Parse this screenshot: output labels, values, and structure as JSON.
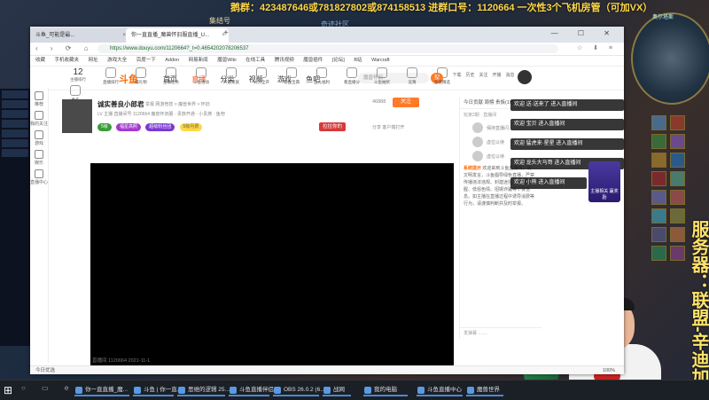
{
  "overlay": {
    "top_banner": "鹅群：423487646或781827802或874158513   进群口号：1120664   一次性3个飞机房管（可加VX）",
    "game_label_1": "集结号",
    "game_label_2": "奇迹社区",
    "server_vertical": "服务器：联盟-辛迪加",
    "minimap_label": "奥尔塔斯",
    "notifications": [
      "欢迎 送·送来了 进入直播间",
      "欢迎 宝贝 进入直播间",
      "欢迎 猛虎来·星星 进入直播间",
      "欢迎 龙头大马哥 进入直播间",
      "欢迎 小熊 进入直播间"
    ],
    "side_card": "主播相关 赢奖励"
  },
  "browser": {
    "tabs": [
      {
        "label": "斗鱼_可能是最..."
      },
      {
        "label": "你一直直播_魔兽怀旧服直播_U..."
      }
    ],
    "url": "https://www.douyu.com/1120664?_t=0.4654202078206537",
    "bookmarks": [
      "收藏",
      "手机收藏夹",
      "网址",
      "游戏大全",
      "百度一下",
      "Addon",
      "网易新闻",
      "魔兽Wiki",
      "在线工具",
      "腾讯视频",
      "魔兽插件",
      "[论坛]",
      "B站",
      "Warcraft"
    ],
    "status_left": "今日优选",
    "zoom": "100%"
  },
  "site": {
    "logo": "斗鱼",
    "nav": [
      "首页",
      "直播",
      "分类",
      "视频",
      "游戏",
      "鱼吧"
    ],
    "search_placeholder": "魔兽怀旧",
    "search_btn": "搜",
    "header_icons": [
      "下载",
      "历史",
      "关注",
      "开播",
      "消息",
      "我的"
    ],
    "sidebar": [
      "推荐",
      "我的关注",
      "游戏",
      "娱乐",
      "直播中心"
    ]
  },
  "iconrow": {
    "first_num": "12",
    "first_label": "主播排行",
    "items": [
      "直播排行",
      "赠礼物",
      "主播任务",
      "斗鱼活动",
      "开通贵族",
      "火力全开",
      "粉丝宝典",
      "鱼丸福利",
      "看直播分",
      "斗鱼抽奖",
      "竞猜",
      "鱼塘精选",
      "送鱼丸包",
      "更多"
    ]
  },
  "room": {
    "title": "诚实善良小郎君",
    "subtitle": "举报  网游竞技 > 魔兽世界 > 怀旧",
    "line2": "LV 主播  直播间号 1120664  魔兽怀旧服 · 贵族开通 · 小贵族  · 鱼吧",
    "badges": [
      "5级",
      "福星高照",
      "超级粉丝团",
      "5级月费"
    ],
    "hot": "46888",
    "follow": "关注",
    "report": "拉拉你的",
    "share": "分享  客户端打开"
  },
  "chat": {
    "head": "今日贡献  周榜  贵族(10)  粉丝团",
    "sub": "玩家2期 · 直播间",
    "users": [
      "保持直播闪",
      "虚位以待",
      "虚位以待"
    ],
    "sys_label": "系统提示",
    "sys_text": "欢迎来到斗鱼直播间，请文明发言，斗鱼倡导绿色直播，严禁传播违法违规、封建迷信、暴力血腥、低俗色情、招嫖诈骗等不良信息。如主播在直播过程中诱导消费等行为，请谨慎判断并及时举报。",
    "bottom": "发弹幕  ……"
  },
  "player": {
    "bottom": "直播间  1120664  2021-11-1"
  },
  "taskbar": {
    "items": [
      "你一直直播_魔...",
      "斗鱼 | 你一直...",
      "思维的逻辑 25...",
      "斗鱼直播伴侣",
      "OBS 26.0.2 (6...",
      "战网",
      "我的电脑",
      "斗鱼直播中心",
      "魔兽世界"
    ]
  }
}
